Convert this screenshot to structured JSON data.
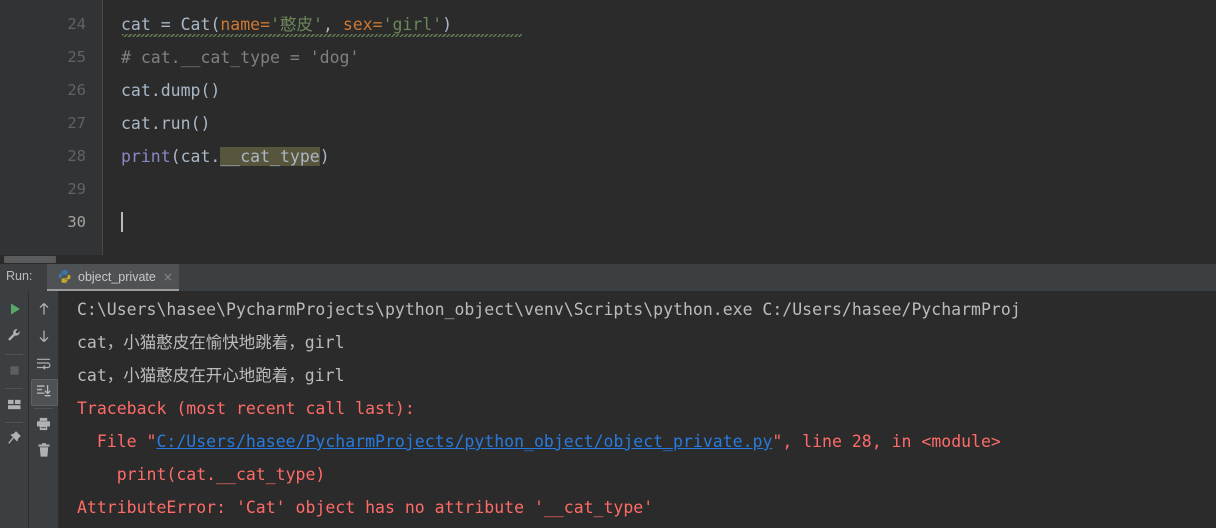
{
  "editor": {
    "lines": [
      {
        "number": "24",
        "tokens": [
          {
            "t": "cat ",
            "c": "tok-default"
          },
          {
            "t": "= ",
            "c": "tok-default"
          },
          {
            "t": "Cat",
            "c": "tok-class"
          },
          {
            "t": "(",
            "c": "tok-paren"
          },
          {
            "t": "name",
            "c": "tok-kwarg"
          },
          {
            "t": "=",
            "c": "tok-kwarg"
          },
          {
            "t": "'憨皮'",
            "c": "tok-string"
          },
          {
            "t": ", ",
            "c": "tok-default"
          },
          {
            "t": "sex",
            "c": "tok-kwarg"
          },
          {
            "t": "=",
            "c": "tok-kwarg"
          },
          {
            "t": "'girl'",
            "c": "tok-string"
          },
          {
            "t": ")",
            "c": "tok-paren"
          }
        ],
        "text": "cat = Cat(name='憨皮', sex='girl')",
        "has_squiggle": true,
        "current": false
      },
      {
        "number": "25",
        "tokens": [
          {
            "t": "# cat.__cat_type = 'dog'",
            "c": "tok-comment"
          }
        ],
        "text": "# cat.__cat_type = 'dog'",
        "has_squiggle": false,
        "current": false
      },
      {
        "number": "26",
        "tokens": [
          {
            "t": "cat",
            "c": "tok-default"
          },
          {
            "t": ".",
            "c": "tok-default"
          },
          {
            "t": "dump",
            "c": "tok-class"
          },
          {
            "t": "()",
            "c": "tok-paren"
          }
        ],
        "text": "cat.dump()",
        "has_squiggle": false,
        "current": false
      },
      {
        "number": "27",
        "tokens": [
          {
            "t": "cat",
            "c": "tok-default"
          },
          {
            "t": ".",
            "c": "tok-default"
          },
          {
            "t": "run",
            "c": "tok-class"
          },
          {
            "t": "()",
            "c": "tok-paren"
          }
        ],
        "text": "cat.run()",
        "has_squiggle": false,
        "current": false
      },
      {
        "number": "28",
        "tokens": [
          {
            "t": "print",
            "c": "tok-builtin"
          },
          {
            "t": "(",
            "c": "tok-paren"
          },
          {
            "t": "cat",
            "c": "tok-default"
          },
          {
            "t": ".",
            "c": "tok-default"
          },
          {
            "t": "__cat_type",
            "c": "tok-default tok-hl"
          },
          {
            "t": ")",
            "c": "tok-paren"
          }
        ],
        "text": "print(cat.__cat_type)",
        "has_squiggle": false,
        "current": false
      },
      {
        "number": "29",
        "tokens": [],
        "text": "",
        "has_squiggle": false,
        "current": false
      },
      {
        "number": "30",
        "tokens": [],
        "text": "",
        "has_squiggle": false,
        "current": true,
        "has_caret": true
      }
    ],
    "selection_text": "__cat_type",
    "colors": {
      "background": "#2B2B2B",
      "gutter": "#313335",
      "caret_row": "#323232",
      "selection_highlight": "#57553B",
      "string": "#6A8759",
      "keyword_arg": "#CC7832",
      "comment": "#808080",
      "default_text": "#A9B7C6",
      "builtin": "#8888C6"
    }
  },
  "run_panel": {
    "label": "Run:",
    "tab": {
      "title": "object_private",
      "icon": "python-icon",
      "close": "×"
    },
    "toolbar": {
      "left_column": [
        {
          "name": "rerun-button",
          "icon": "play-icon",
          "title": "Rerun"
        },
        {
          "name": "settings-button",
          "icon": "wrench-icon",
          "title": "Settings"
        },
        {
          "name": "stop-button",
          "icon": "stop-icon",
          "title": "Stop"
        },
        {
          "name": "layout-button",
          "icon": "layout-icon",
          "title": "Layout"
        },
        {
          "name": "pin-button",
          "icon": "pin-icon",
          "title": "Pin Tab"
        }
      ],
      "right_column": [
        {
          "name": "up-button",
          "icon": "arrow-up-icon",
          "title": "Up the Stack Trace"
        },
        {
          "name": "down-button",
          "icon": "arrow-down-icon",
          "title": "Down the Stack Trace"
        },
        {
          "name": "soft-wrap-button",
          "icon": "soft-wrap-icon",
          "title": "Soft-Wrap"
        },
        {
          "name": "scroll-to-end-button",
          "icon": "scroll-to-end-icon",
          "title": "Scroll to the end",
          "active": true
        },
        {
          "name": "print-button",
          "icon": "printer-icon",
          "title": "Print"
        },
        {
          "name": "clear-all-button",
          "icon": "trash-icon",
          "title": "Clear All"
        }
      ]
    },
    "console": {
      "lines": [
        {
          "kind": "command",
          "segments": [
            {
              "t": "C:\\Users\\hasee\\PycharmProjects\\python_object\\venv\\Scripts\\python.exe C:/Users/hasee/PycharmProj",
              "c": "c-out"
            }
          ],
          "text": "C:\\Users\\hasee\\PycharmProjects\\python_object\\venv\\Scripts\\python.exe C:/Users/hasee/PycharmProj"
        },
        {
          "kind": "stdout",
          "segments": [
            {
              "t": "cat，小猫憨皮在愉快地跳着，girl",
              "c": "c-out"
            }
          ],
          "text": "cat，小猫憨皮在愉快地跳着，girl"
        },
        {
          "kind": "stdout",
          "segments": [
            {
              "t": "cat，小猫憨皮在开心地跑着，girl",
              "c": "c-out"
            }
          ],
          "text": "cat，小猫憨皮在开心地跑着，girl"
        },
        {
          "kind": "stderr",
          "segments": [
            {
              "t": "Traceback (most recent call last):",
              "c": "c-err"
            }
          ],
          "text": "Traceback (most recent call last):"
        },
        {
          "kind": "stderr",
          "segments": [
            {
              "t": "  File \"",
              "c": "c-err"
            },
            {
              "t": "C:/Users/hasee/PycharmProjects/python_object/object_private.py",
              "c": "c-link"
            },
            {
              "t": "\", line 28, in <module>",
              "c": "c-err"
            }
          ],
          "text": "  File \"C:/Users/hasee/PycharmProjects/python_object/object_private.py\", line 28, in <module>"
        },
        {
          "kind": "stderr",
          "segments": [
            {
              "t": "    print(cat.__cat_type)",
              "c": "c-err"
            }
          ],
          "text": "    print(cat.__cat_type)"
        },
        {
          "kind": "stderr",
          "segments": [
            {
              "t": "AttributeError: 'Cat' object has no attribute '__cat_type'",
              "c": "c-err"
            }
          ],
          "text": "AttributeError: 'Cat' object has no attribute '__cat_type'"
        }
      ],
      "colors": {
        "background": "#2B2B2B",
        "stdout": "#BBBBBB",
        "stderr": "#FF6B68",
        "link": "#287BDE"
      }
    }
  }
}
